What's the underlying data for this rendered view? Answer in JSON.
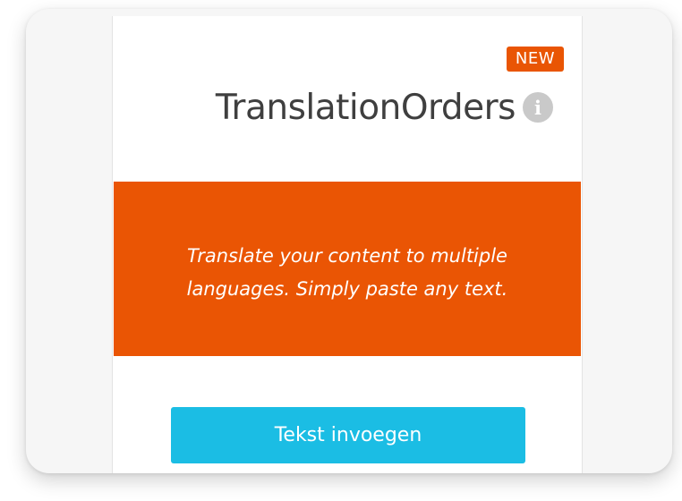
{
  "card": {
    "badge": "NEW",
    "title": "TranslationOrders",
    "info_icon": "info-icon",
    "banner_text": "Translate your content to multiple languages. Simply paste any text.",
    "cta_label": "Tekst invoegen"
  },
  "colors": {
    "accent_orange": "#ea5504",
    "button_blue": "#1bbde4",
    "title_text": "#3f3f3f",
    "info_icon_gray": "#c9c9c9"
  }
}
